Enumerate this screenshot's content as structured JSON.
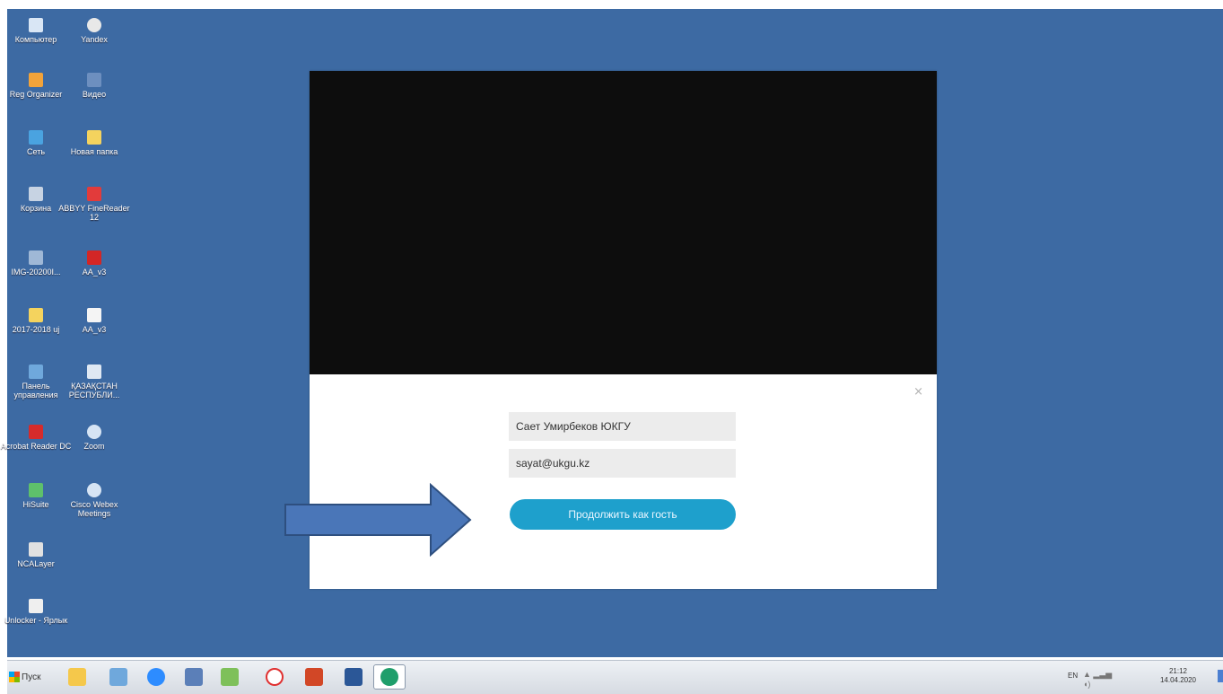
{
  "desktop_icons": [
    {
      "label": "Компьютер",
      "icon": "computer-icon",
      "color": "#d9e6f5"
    },
    {
      "label": "Yandex",
      "icon": "yandex-browser-icon",
      "color": "#e8e8e8"
    },
    {
      "label": "Reg Organizer",
      "icon": "reg-organizer-icon",
      "color": "#f2a33a"
    },
    {
      "label": "Видео",
      "icon": "video-folder-icon",
      "color": "#6d8fbf"
    },
    {
      "label": "Сеть",
      "icon": "network-icon",
      "color": "#4aa3e0"
    },
    {
      "label": "Новая папка",
      "icon": "folder-icon",
      "color": "#f4d35e"
    },
    {
      "label": "Корзина",
      "icon": "recycle-bin-icon",
      "color": "#c7d3e3"
    },
    {
      "label": "ABBYY FineReader 12",
      "icon": "abbyy-icon",
      "color": "#e23b3b"
    },
    {
      "label": "IMG-20200I...",
      "icon": "image-file-icon",
      "color": "#9fb8d6"
    },
    {
      "label": "AA_v3",
      "icon": "ammyy-admin-icon",
      "color": "#d32626"
    },
    {
      "label": "2017-2018 uj",
      "icon": "folder-icon",
      "color": "#f4d35e"
    },
    {
      "label": "AA_v3",
      "icon": "document-icon",
      "color": "#f4f4f4"
    },
    {
      "label": "Панель управления",
      "icon": "control-panel-icon",
      "color": "#6fa8dc"
    },
    {
      "label": "ҚАЗАҚСТАН РЕСПУБЛИ...",
      "icon": "shortcut-doc-icon",
      "color": "#dfe8f3"
    },
    {
      "label": "Acrobat Reader DC",
      "icon": "acrobat-icon",
      "color": "#d62b2b"
    },
    {
      "label": "Zoom",
      "icon": "zoom-icon",
      "color": "#d6e4f4"
    },
    {
      "label": "HiSuite",
      "icon": "hisuite-icon",
      "color": "#5ec06b"
    },
    {
      "label": "Cisco Webex Meetings",
      "icon": "webex-icon",
      "color": "#d6e4f4"
    },
    {
      "label": "NCALayer",
      "icon": "ncalayer-icon",
      "color": "#e1e1e1"
    },
    {
      "label": "Unlocker - Ярлык",
      "icon": "unlocker-icon",
      "color": "#efefef"
    }
  ],
  "dialog": {
    "name_value": "Сает Умирбеков ЮКГУ",
    "email_value": "sayat@ukgu.kz",
    "join_label": "Продолжить как гость",
    "close_glyph": "×"
  },
  "taskbar": {
    "start_label": "Пуск",
    "items": [
      {
        "icon": "explorer-folder-icon",
        "color": "#f5c84b"
      },
      {
        "icon": "remote-desktop-icon",
        "color": "#6fa8dc"
      },
      {
        "icon": "zoom-icon",
        "color": "#2d8cff"
      },
      {
        "icon": "people-icon",
        "color": "#5b7fb8"
      },
      {
        "icon": "paint-icon",
        "color": "#7ec05a"
      },
      {
        "icon": "yandex-browser-icon",
        "color": "#e03030"
      },
      {
        "icon": "powerpoint-icon",
        "color": "#d24726"
      },
      {
        "icon": "word-icon",
        "color": "#2b5797"
      },
      {
        "icon": "webex-circle-icon",
        "color": "#1f9e6b"
      }
    ],
    "tray": {
      "lang": "EN",
      "time": "21:12",
      "date": "14.04.2020"
    }
  }
}
